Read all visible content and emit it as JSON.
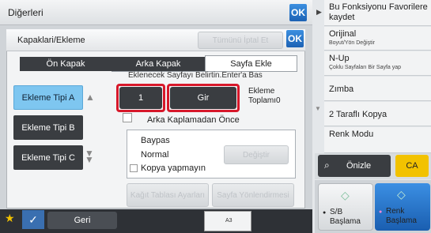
{
  "topbar": {
    "title": "Diğerleri",
    "ok_label": "OK"
  },
  "dialog": {
    "title": "Kapaklari/Ekleme",
    "cancel_all": "Tümünü İptal Et",
    "ok_label": "OK",
    "tabs": [
      "Ön Kapak",
      "Arka Kapak",
      "Sayfa Ekle"
    ],
    "instruction": "Eklenecek Sayfayı Belirtin.Enter'a Bas",
    "insert_types": [
      "Ekleme Tipi A",
      "Ekleme Tipi B",
      "Ekleme Tipi C"
    ],
    "page_value": "1",
    "enter_label": "Gir",
    "total_label": "Ekleme Toplamı",
    "total_value": "0",
    "front_checkbox": "Arka Kaplamadan Önce",
    "paper": {
      "tray": "Baypas",
      "type": "Normal",
      "change_label": "Değiştir"
    },
    "copy_checkbox": "Kopya yapmayın",
    "tray_settings": "Kağıt Tablası Ayarları",
    "page_orientation": "Sayfa Yönlendirmesi"
  },
  "right_panel": {
    "items": [
      {
        "label": "Bu Fonksiyonu Favorilere kaydet",
        "sub": ""
      },
      {
        "label": "Orijinal",
        "sub": "Boyut/Yön Değiştir"
      },
      {
        "label": "N-Up",
        "sub": "Çoklu Sayfaları Bir Sayfa yap"
      },
      {
        "label": "Zımba",
        "sub": ""
      },
      {
        "label": "2 Taraflı Kopya",
        "sub": ""
      },
      {
        "label": "Renk Modu",
        "sub": ""
      }
    ],
    "preview_label": "Önizle",
    "ca_label": "CA",
    "bw_start": {
      "line1": "S/B",
      "line2": "Başlama"
    },
    "color_start": {
      "line1": "Renk",
      "line2": "Başlama"
    }
  },
  "bottom": {
    "back_label": "Geri",
    "paper_label": "A3"
  },
  "colors": {
    "accent": "#1c62b4",
    "selected": "#7ec6f0",
    "highlight": "#d7182a"
  }
}
